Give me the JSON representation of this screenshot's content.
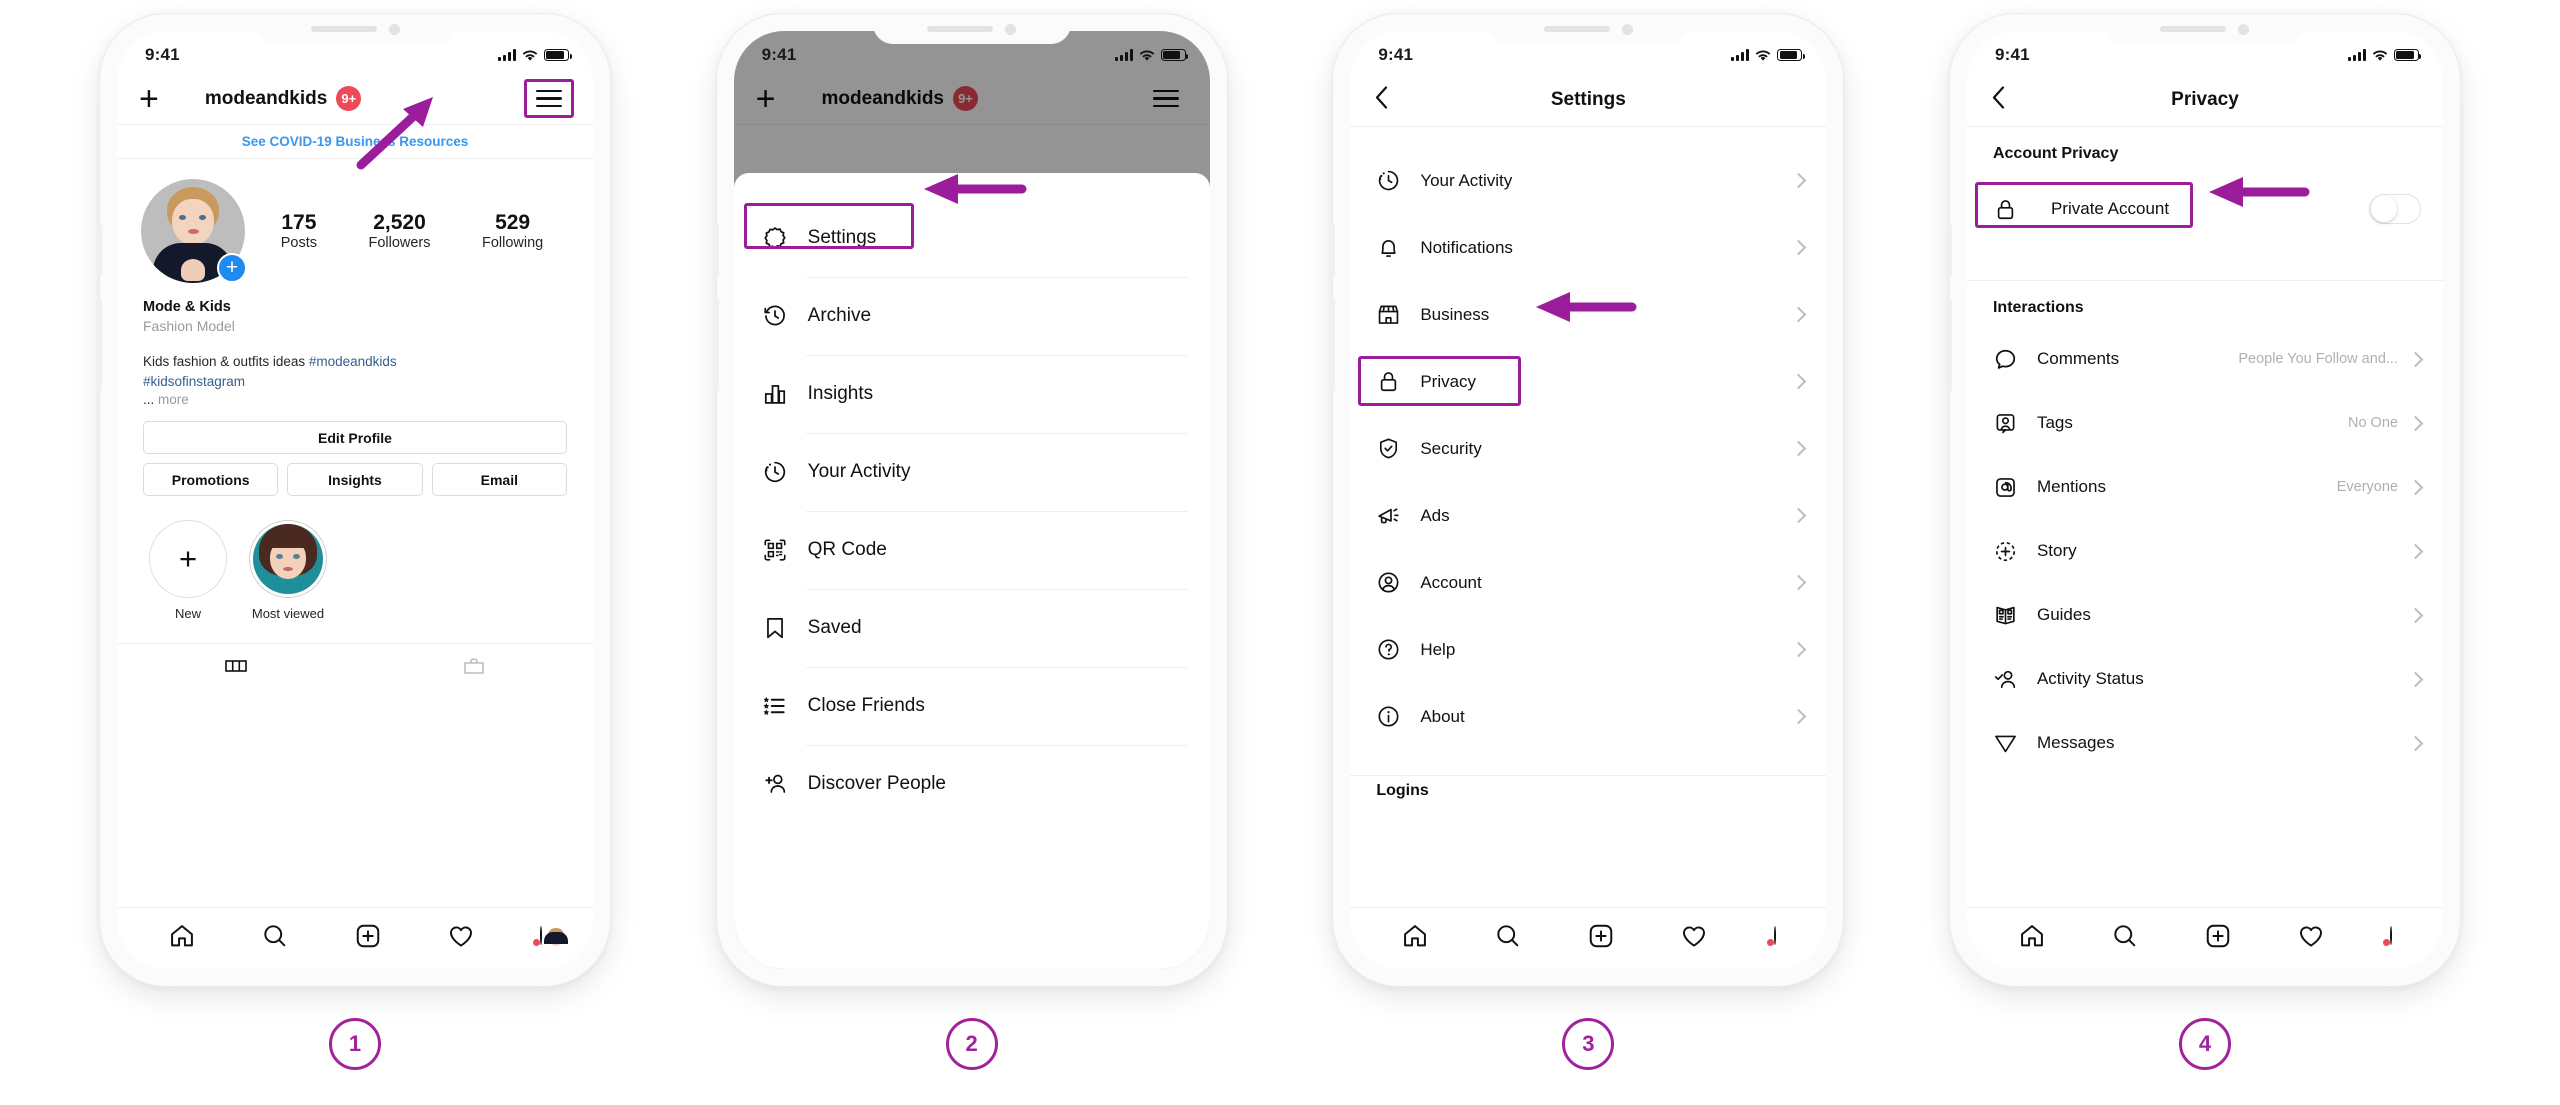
{
  "accent": "#9B1D9B",
  "badge_accent": "#A2229C",
  "link_blue": "#3897f0",
  "notification_red": "#ed4956",
  "status_bar": {
    "time": "9:41"
  },
  "steps": [
    {
      "number": "1"
    },
    {
      "number": "2"
    },
    {
      "number": "3"
    },
    {
      "number": "4"
    }
  ],
  "screen1": {
    "header": {
      "add_icon": "plus-icon",
      "username": "modeandkids",
      "badge": "9+",
      "menu_icon": "hamburger-icon"
    },
    "covid_banner": "See COVID-19 Business Resources",
    "profile": {
      "avatar": "profile-photo",
      "add_story_icon": "plus-circle-icon",
      "stats": [
        {
          "num": "175",
          "label": "Posts"
        },
        {
          "num": "2,520",
          "label": "Followers"
        },
        {
          "num": "529",
          "label": "Following"
        }
      ],
      "name": "Mode & Kids",
      "category": "Fashion Model",
      "bio_text": "Kids fashion & outfits ideas ",
      "bio_tag1": "#modeandkids",
      "bio_tag2": "#kidsofinstagram",
      "more_dots": "... ",
      "more_label": "more"
    },
    "buttons": {
      "edit_profile": "Edit Profile",
      "promotions": "Promotions",
      "insights": "Insights",
      "email": "Email"
    },
    "highlights": [
      {
        "label": "New",
        "icon": "plus-icon"
      },
      {
        "label": "Most viewed",
        "icon": "highlight-photo"
      }
    ],
    "tabs": [
      "grid-tab-icon",
      "tagged-tab-icon"
    ],
    "bottom_nav": [
      "home-icon",
      "search-icon",
      "add-post-icon",
      "activity-heart-icon",
      "profile-avatar"
    ]
  },
  "screen2": {
    "header": {
      "add_icon": "plus-icon",
      "username": "modeandkids",
      "badge": "9+",
      "menu_icon": "hamburger-icon"
    },
    "menu": [
      {
        "label": "Settings",
        "icon": "gear-icon"
      },
      {
        "label": "Archive",
        "icon": "archive-clock-icon"
      },
      {
        "label": "Insights",
        "icon": "insights-bar-icon"
      },
      {
        "label": "Your Activity",
        "icon": "activity-clock-icon"
      },
      {
        "label": "QR Code",
        "icon": "qr-code-icon"
      },
      {
        "label": "Saved",
        "icon": "bookmark-icon"
      },
      {
        "label": "Close Friends",
        "icon": "close-friends-star-list-icon"
      },
      {
        "label": "Discover People",
        "icon": "discover-people-icon"
      }
    ]
  },
  "screen3": {
    "title": "Settings",
    "back_icon": "chevron-left-icon",
    "items": [
      {
        "label": "Your Activity",
        "icon": "activity-clock-icon"
      },
      {
        "label": "Notifications",
        "icon": "bell-icon"
      },
      {
        "label": "Business",
        "icon": "storefront-icon"
      },
      {
        "label": "Privacy",
        "icon": "lock-icon"
      },
      {
        "label": "Security",
        "icon": "shield-check-icon"
      },
      {
        "label": "Ads",
        "icon": "megaphone-icon"
      },
      {
        "label": "Account",
        "icon": "account-circle-icon"
      },
      {
        "label": "Help",
        "icon": "help-question-icon"
      },
      {
        "label": "About",
        "icon": "info-icon"
      }
    ],
    "next_section": "Logins",
    "bottom_nav": [
      "home-icon",
      "search-icon",
      "add-post-icon",
      "activity-heart-icon",
      "profile-avatar"
    ]
  },
  "screen4": {
    "title": "Privacy",
    "back_icon": "chevron-left-icon",
    "section_account_privacy": "Account Privacy",
    "private_account": {
      "label": "Private Account",
      "icon": "lock-icon",
      "toggle": "off"
    },
    "section_interactions": "Interactions",
    "items": [
      {
        "label": "Comments",
        "value": "People You Follow and...",
        "icon": "comment-bubble-icon"
      },
      {
        "label": "Tags",
        "value": "No One",
        "icon": "tag-person-icon"
      },
      {
        "label": "Mentions",
        "value": "Everyone",
        "icon": "at-mention-icon"
      },
      {
        "label": "Story",
        "value": "",
        "icon": "story-plus-icon"
      },
      {
        "label": "Guides",
        "value": "",
        "icon": "guides-book-icon"
      },
      {
        "label": "Activity Status",
        "value": "",
        "icon": "activity-status-icon"
      },
      {
        "label": "Messages",
        "value": "",
        "icon": "paper-plane-icon"
      }
    ],
    "bottom_nav": [
      "home-icon",
      "search-icon",
      "add-post-icon",
      "activity-heart-icon",
      "profile-avatar"
    ]
  }
}
